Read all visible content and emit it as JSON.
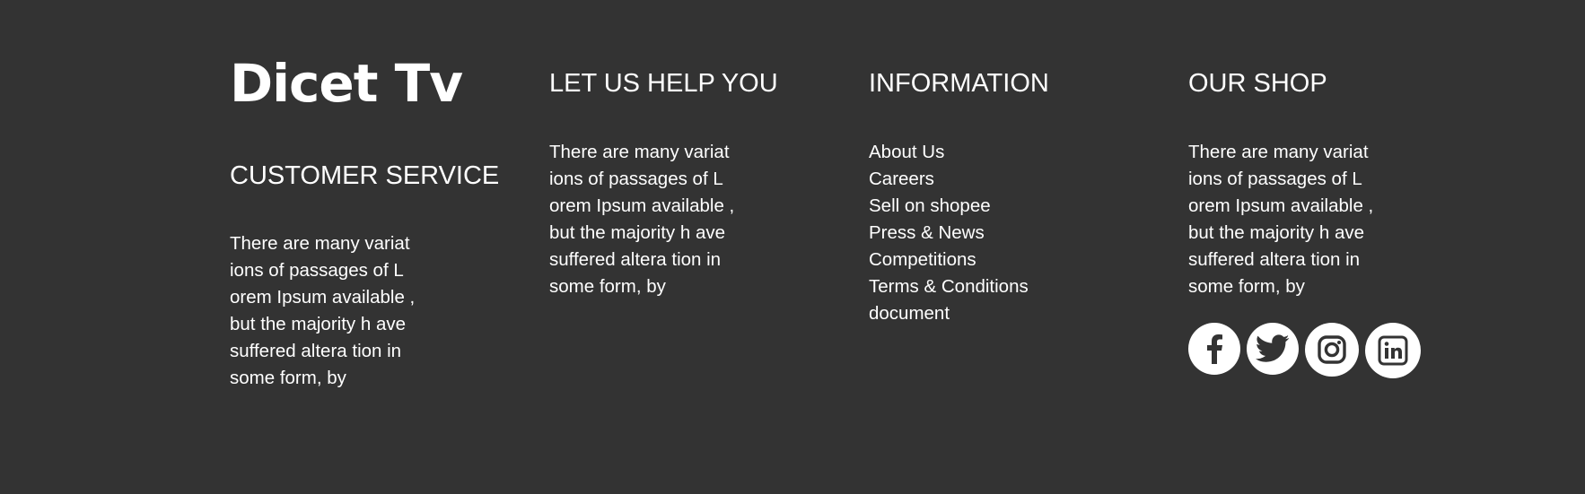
{
  "brand": {
    "logo_text": "Dicet Tv"
  },
  "customer_service": {
    "heading": "CUSTOMER SERVICE",
    "lines": [
      "There are many variat",
      "ions of passages of L",
      "orem Ipsum available ,",
      "but the majority h ave",
      "suffered altera tion in",
      "some form, by"
    ]
  },
  "help": {
    "heading": "LET US HELP YOU",
    "lines": [
      "There are many variat",
      "ions of passages of L",
      "orem Ipsum available ,",
      "but the majority h ave",
      "suffered altera tion in",
      "some form, by"
    ]
  },
  "information": {
    "heading": "INFORMATION",
    "links": [
      "About Us",
      "Careers",
      "Sell on shopee",
      "Press & News",
      "Competitions",
      "Terms & Conditions",
      "document"
    ]
  },
  "shop": {
    "heading": "OUR SHOP",
    "lines": [
      "There are many variat",
      "ions of passages of L",
      "orem Ipsum available ,",
      "but the majority h ave",
      "suffered altera tion in",
      "some form, by"
    ],
    "social_icons": [
      "facebook-icon",
      "twitter-icon",
      "instagram-icon",
      "linkedin-icon"
    ]
  },
  "colors": {
    "background": "#333333",
    "text": "#ffffff",
    "icon": "#333333"
  }
}
